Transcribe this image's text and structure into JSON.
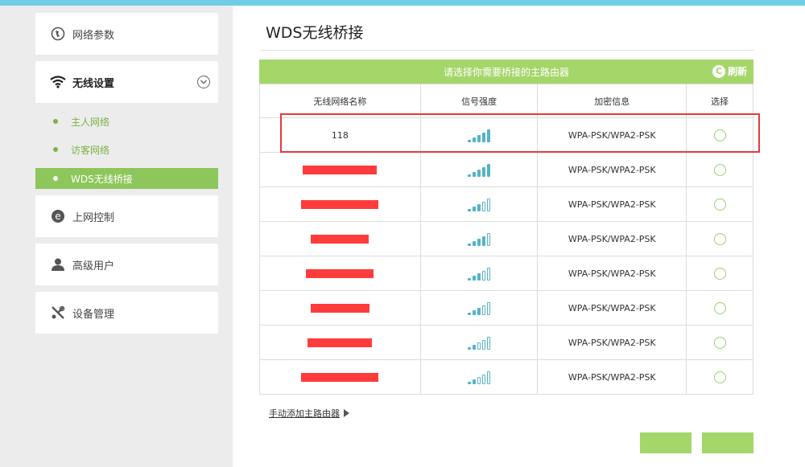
{
  "sidebar": {
    "network_params": "网络参数",
    "wireless": "无线设置",
    "sub": [
      "主人网络",
      "访客网络",
      "WDS无线桥接"
    ],
    "internet_control": "上网控制",
    "advanced_user": "高级用户",
    "device_mgmt": "设备管理"
  },
  "page": {
    "title": "WDS无线桥接"
  },
  "panel": {
    "header": "请选择你需要桥接的主路由器",
    "refresh": "刷新",
    "columns": [
      "无线网络名称",
      "信号强度",
      "加密信息",
      "选择"
    ],
    "rows": [
      {
        "ssid": "118",
        "signal_bars": 5,
        "security": "WPA-PSK/WPA2-PSK"
      },
      {
        "ssid": "",
        "signal_bars": 5,
        "security": "WPA-PSK/WPA2-PSK"
      },
      {
        "ssid": "",
        "signal_bars": 3,
        "security": "WPA-PSK/WPA2-PSK"
      },
      {
        "ssid": "",
        "signal_bars": 4,
        "security": "WPA-PSK/WPA2-PSK"
      },
      {
        "ssid": "",
        "signal_bars": 3,
        "security": "WPA-PSK/WPA2-PSK"
      },
      {
        "ssid": "",
        "signal_bars": 3,
        "security": "WPA-PSK/WPA2-PSK"
      },
      {
        "ssid": "",
        "signal_bars": 2,
        "security": "WPA-PSK/WPA2-PSK"
      },
      {
        "ssid": "",
        "signal_bars": 2,
        "security": "WPA-PSK/WPA2-PSK"
      }
    ]
  },
  "add_link": "手动添加主路由器",
  "colors": {
    "accent": "#a5d66a",
    "highlight": "#e43b3b",
    "signal": "#55b3c7",
    "redaction": "#ff3b3b"
  }
}
